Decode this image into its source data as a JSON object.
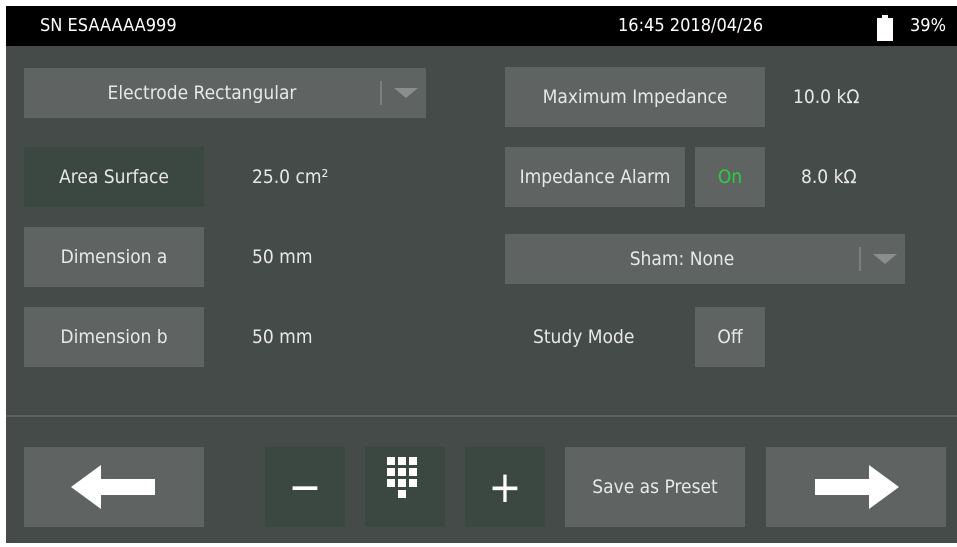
{
  "status_bar": {
    "serial": "SN ESAAAAA999",
    "datetime": "16:45 2018/04/26",
    "battery": "39%",
    "battery_icon": "battery-icon"
  },
  "settings": {
    "electrode_type": "Electrode Rectangular",
    "area_surface_label": "Area Surface",
    "area_surface_value": "25.0 cm²",
    "dimension_a_label": "Dimension a",
    "dimension_a_value": "50 mm",
    "dimension_b_label": "Dimension b",
    "dimension_b_value": "50 mm",
    "max_impedance_label": "Maximum Impedance",
    "max_impedance_value": "10.0 kΩ",
    "impedance_alarm_label": "Impedance Alarm",
    "impedance_alarm_state": "On",
    "impedance_alarm_value": "8.0 kΩ",
    "sham_select": "Sham: None",
    "study_mode_label": "Study Mode",
    "study_mode_state": "Off"
  },
  "toolbar": {
    "minus": "−",
    "plus": "+",
    "save_preset": "Save as Preset"
  },
  "colors": {
    "background": "#454b49",
    "button": "#5f6462",
    "on_text": "#2ecc40"
  }
}
